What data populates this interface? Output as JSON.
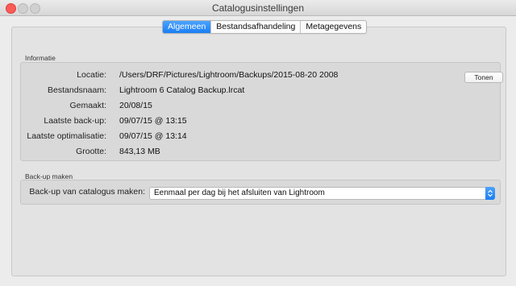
{
  "window": {
    "title": "Catalogusinstellingen"
  },
  "tabs": [
    {
      "label": "Algemeen",
      "active": true
    },
    {
      "label": "Bestandsafhandeling",
      "active": false
    },
    {
      "label": "Metagegevens",
      "active": false
    }
  ],
  "informatie": {
    "section_label": "Informatie",
    "rows": [
      {
        "label": "Locatie:",
        "value": "/Users/DRF/Pictures/Lightroom/Backups/2015-08-20 2008"
      },
      {
        "label": "Bestandsnaam:",
        "value": "Lightroom 6 Catalog Backup.lrcat"
      },
      {
        "label": "Gemaakt:",
        "value": "20/08/15"
      },
      {
        "label": "Laatste back-up:",
        "value": "09/07/15 @ 13:15"
      },
      {
        "label": "Laatste optimalisatie:",
        "value": "09/07/15 @ 13:14"
      },
      {
        "label": "Grootte:",
        "value": "843,13 MB"
      }
    ],
    "show_button_label": "Tonen"
  },
  "backup": {
    "section_label": "Back-up maken",
    "label": "Back-up van catalogus maken:",
    "selected": "Eenmaal per dag bij het afsluiten van Lightroom"
  },
  "colors": {
    "accent": "#1a7ef5",
    "close_button": "#fc5b57"
  }
}
